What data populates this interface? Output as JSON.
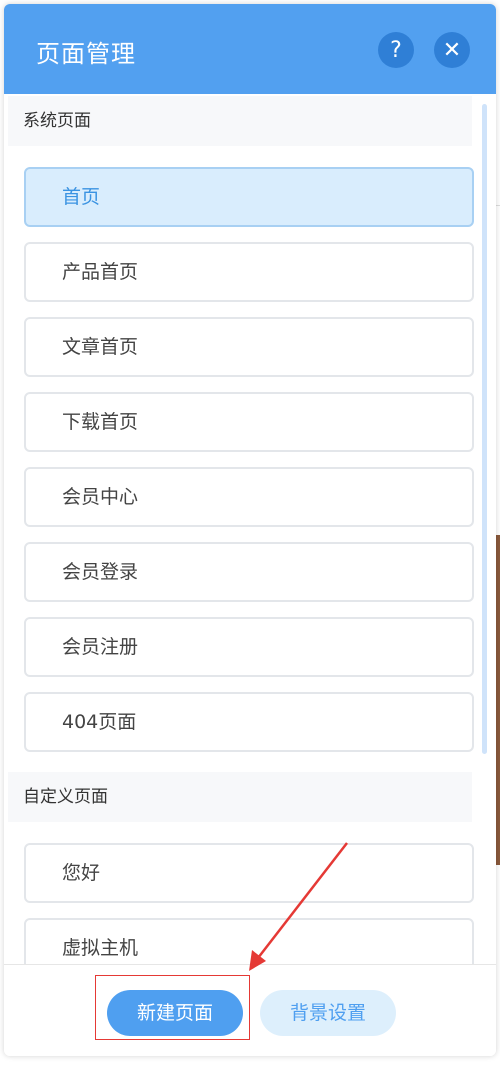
{
  "panel": {
    "title": "页面管理",
    "help_icon": "?",
    "close_icon": "✕"
  },
  "sections": {
    "system": {
      "title": "系统页面",
      "items": [
        "首页",
        "产品首页",
        "文章首页",
        "下载首页",
        "会员中心",
        "会员登录",
        "会员注册",
        "404页面"
      ],
      "active_index": 0
    },
    "custom": {
      "title": "自定义页面",
      "items": [
        "您好",
        "虚拟主机"
      ]
    }
  },
  "footer": {
    "new_page_label": "新建页面",
    "background_label": "背景设置"
  },
  "colors": {
    "header": "#52a0f0",
    "accent": "#4f9ff0",
    "annotation": "#e53935"
  }
}
